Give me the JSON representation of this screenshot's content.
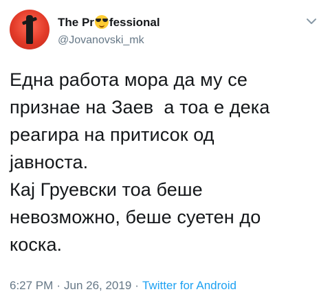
{
  "tweet": {
    "display_name_before": "The Pr",
    "display_name_emoji": "smiling-face-with-sunglasses",
    "display_name_after": "fessional",
    "handle": "@Jovanovski_mk",
    "text": "Една работа мора да му се\nпризнае на Заев  а тоа е дека\nреагира на притисок од\nјавноста.\nКај Груевски тоа беше\nневозможно, беше суетен до\nкоска.",
    "time": "6:27 PM",
    "date": "Jun 26, 2019",
    "separator": "·",
    "source": "Twitter for Android",
    "menu_icon": "chevron-down-icon"
  },
  "colors": {
    "text": "#14171a",
    "secondary": "#657786",
    "link": "#1da1f2",
    "avatar": "#e23a28"
  }
}
